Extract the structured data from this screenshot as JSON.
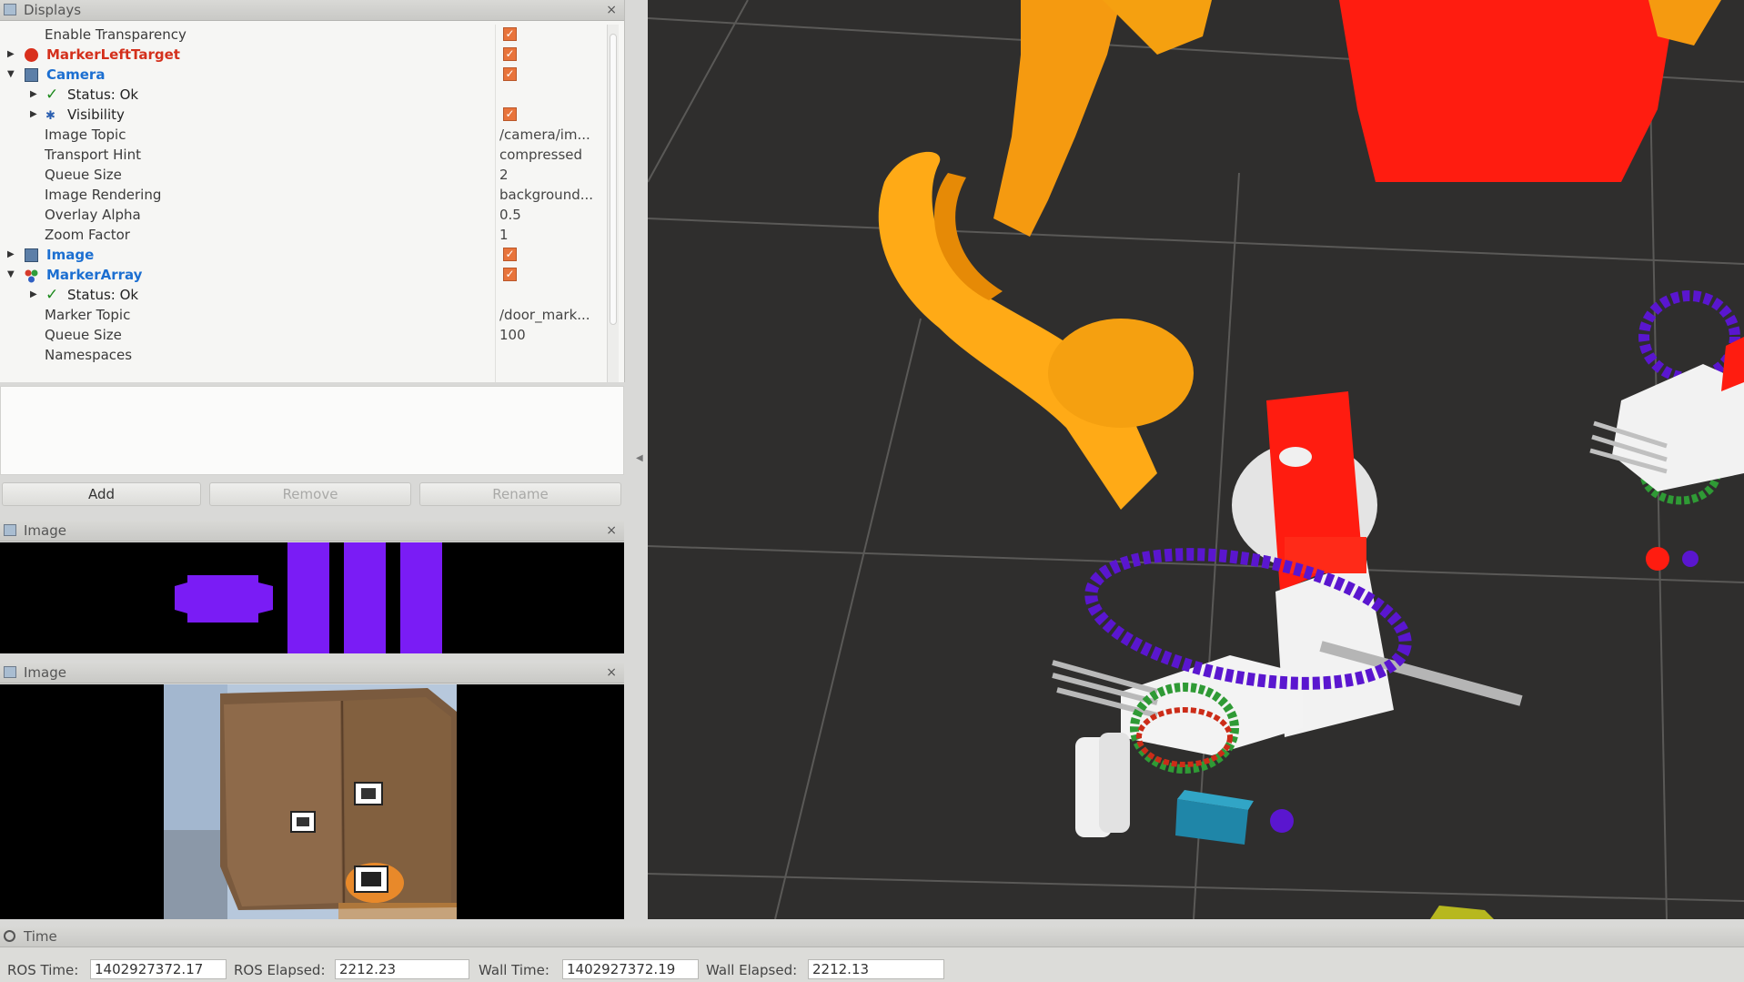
{
  "displays": {
    "title": "Displays",
    "rows": [
      {
        "label": "Enable Transparency",
        "value": "",
        "checked": true
      },
      {
        "label": "MarkerLeftTarget",
        "value": "",
        "checked": true
      },
      {
        "label": "Camera",
        "value": "",
        "checked": true
      },
      {
        "label": "Status: Ok",
        "value": "",
        "checked": false
      },
      {
        "label": "Visibility",
        "value": "",
        "checked": true
      },
      {
        "label": "Image Topic",
        "value": "/camera/im...",
        "checked": false
      },
      {
        "label": "Transport Hint",
        "value": "compressed",
        "checked": false
      },
      {
        "label": "Queue Size",
        "value": "2",
        "checked": false
      },
      {
        "label": "Image Rendering",
        "value": "background...",
        "checked": false
      },
      {
        "label": "Overlay Alpha",
        "value": "0.5",
        "checked": false
      },
      {
        "label": "Zoom Factor",
        "value": "1",
        "checked": false
      },
      {
        "label": "Image",
        "value": "",
        "checked": true
      },
      {
        "label": "MarkerArray",
        "value": "",
        "checked": true
      },
      {
        "label": "Status: Ok",
        "value": "",
        "checked": false
      },
      {
        "label": "Marker Topic",
        "value": "/door_mark...",
        "checked": false
      },
      {
        "label": "Queue Size",
        "value": "100",
        "checked": false
      },
      {
        "label": "Namespaces",
        "value": "",
        "checked": false
      }
    ],
    "buttons": {
      "add": "Add",
      "remove": "Remove",
      "rename": "Rename"
    }
  },
  "image_panel_1": {
    "title": "Image"
  },
  "image_panel_2": {
    "title": "Image"
  },
  "time": {
    "title": "Time",
    "ros_time_label": "ROS Time:",
    "ros_time": "1402927372.17",
    "ros_elapsed_label": "ROS Elapsed:",
    "ros_elapsed": "2212.23",
    "wall_time_label": "Wall Time:",
    "wall_time": "1402927372.19",
    "wall_elapsed_label": "Wall Elapsed:",
    "wall_elapsed": "2212.13"
  },
  "colors": {
    "accent_orange": "#e8743b",
    "header_blue": "#1c6fd1",
    "error_red": "#d4301c",
    "marker_purple": "#7b1ff0",
    "arm_orange": "#f59a10",
    "link_red": "#ff1c10"
  },
  "icons": [
    "displays-icon",
    "error-icon",
    "camera-icon",
    "check-icon",
    "eye-icon",
    "image-icon",
    "marker-array-icon",
    "clock-icon",
    "close-icon"
  ]
}
